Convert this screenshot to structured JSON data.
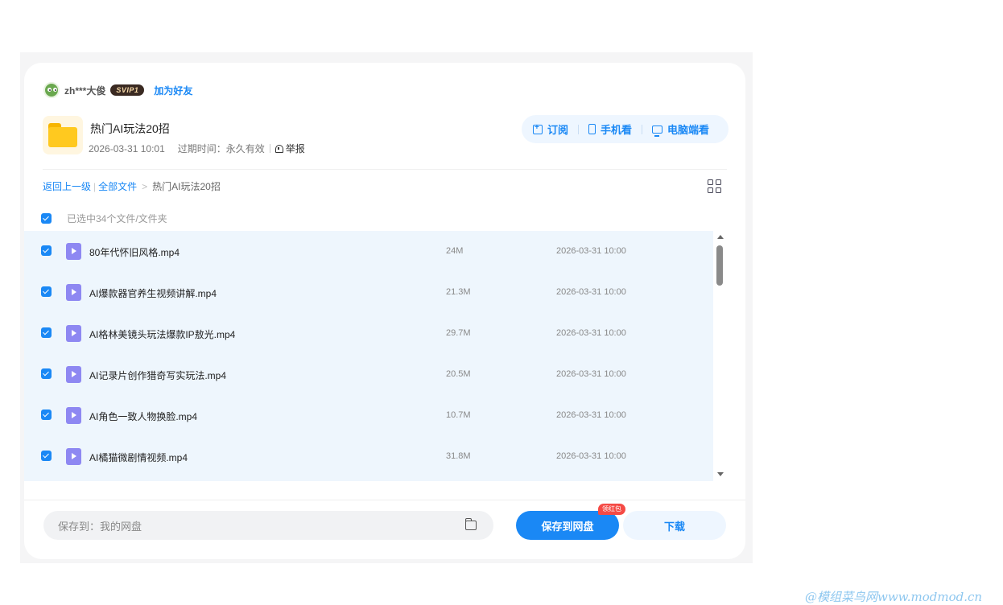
{
  "user": {
    "name": "zh***大俊",
    "vip_badge": "SVIP1",
    "add_friend": "加为好友"
  },
  "share": {
    "title": "热门AI玩法20招",
    "created": "2026-03-31 10:01",
    "expire_label": "过期时间：永久有效",
    "report": "举报"
  },
  "actions": {
    "subscribe": "订阅",
    "phone": "手机看",
    "pc": "电脑端看"
  },
  "breadcrumb": {
    "back": "返回上一级",
    "all": "全部文件",
    "current": "热门AI玩法20招"
  },
  "selection": {
    "text": "已选中34个文件/文件夹"
  },
  "files": [
    {
      "name": "80年代怀旧风格.mp4",
      "size": "24M",
      "date": "2026-03-31 10:00"
    },
    {
      "name": "AI爆款器官养生视频讲解.mp4",
      "size": "21.3M",
      "date": "2026-03-31 10:00"
    },
    {
      "name": "AI格林美镜头玩法爆款IP敖光.mp4",
      "size": "29.7M",
      "date": "2026-03-31 10:00"
    },
    {
      "name": "AI记录片创作猎奇写实玩法.mp4",
      "size": "20.5M",
      "date": "2026-03-31 10:00"
    },
    {
      "name": "AI角色一致人物换脸.mp4",
      "size": "10.7M",
      "date": "2026-03-31 10:00"
    },
    {
      "name": "AI橘猫微剧情视频.mp4",
      "size": "31.8M",
      "date": "2026-03-31 10:00"
    }
  ],
  "footer": {
    "save_to": "保存到：我的网盘",
    "save_button": "保存到网盘",
    "red_badge": "领红包",
    "download": "下载"
  },
  "watermark": "@模组菜鸟网www.modmod.cn",
  "colors": {
    "accent": "#1a88f5",
    "selected_row_bg": "#eef6fd",
    "badge_red": "#f54a45",
    "folder": "#ffc91f"
  },
  "icons": [
    "avatar-icon",
    "folder-icon",
    "report-icon",
    "subscribe-icon",
    "phone-icon",
    "monitor-icon",
    "grid-view-icon",
    "video-file-icon",
    "folder-picker-icon"
  ]
}
